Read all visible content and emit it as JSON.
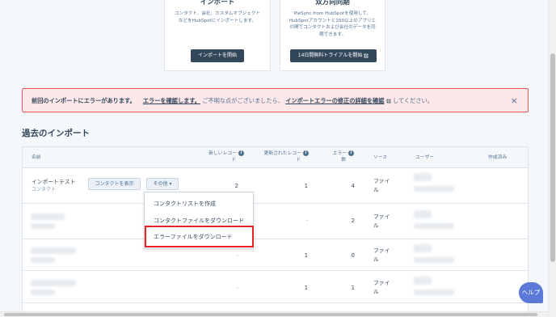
{
  "cards": [
    {
      "title": "インポート",
      "desc": "コンタクト、会社、カスタムオブジェクトなどをHubSpotにインポートします。",
      "button": "インポートを開始"
    },
    {
      "title": "双方向同期",
      "desc": "PieSync from HubSpotを使用して、HubSpotアカウントと200以上のアプリとの間でコンタクトおよび会社のデータを同期できます。",
      "button": "14日間無料トライアルを開始",
      "button_icon": "external-link-icon"
    }
  ],
  "error_banner": {
    "bold": "前回のインポートにエラーがあります。",
    "link1": "エラーを確認します。",
    "middle": "ご不明な点がございましたら、",
    "link2": "インポートエラーの修正の詳細を確認",
    "suffix": "してください。",
    "close": "×"
  },
  "section_title": "過去のインポート",
  "table": {
    "headers": {
      "name": "名前",
      "new_records_line1": "新しいレコー",
      "new_records_line2": "ド",
      "updated_records_line1": "更新されたレコー",
      "updated_records_line2": "ド",
      "errors_line1": "エラー",
      "errors_line2": "数",
      "source": "ソース",
      "user": "ユーザー",
      "created": "作成済み"
    },
    "rows": [
      {
        "name": "インポートテスト",
        "type": "コンタクト",
        "new": "2",
        "updated": "1",
        "errors": "4",
        "source_line1": "ファイ",
        "source_line2": "ル"
      },
      {
        "name": "",
        "type": "",
        "new": "",
        "updated": "-",
        "errors": "2",
        "source_line1": "ファイ",
        "source_line2": "ル"
      },
      {
        "name": "",
        "type": "",
        "new": "-",
        "updated": "1",
        "errors": "0",
        "source_line1": "ファイ",
        "source_line2": "ル"
      },
      {
        "name": "",
        "type": "",
        "new": "-",
        "updated": "1",
        "errors": "1",
        "source_line1": "ファイ",
        "source_line2": "ル"
      }
    ],
    "row_buttons": {
      "view_contacts": "コンタクトを表示",
      "more": "その他 ▾"
    }
  },
  "dropdown": {
    "items": [
      "コンタクトリストを作成",
      "コンタクトファイルをダウンロード",
      "エラーファイルをダウンロード"
    ]
  },
  "help_button": "ヘルプ"
}
